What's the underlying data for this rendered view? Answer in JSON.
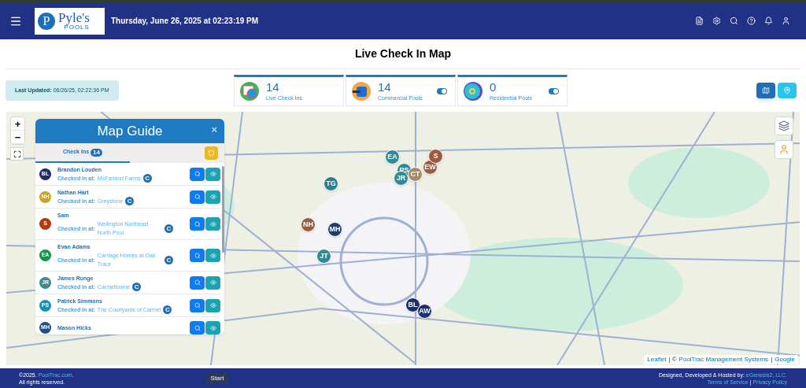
{
  "header": {
    "logo": {
      "initial": "P",
      "name": "Pyle's",
      "tagline": "POOLS"
    },
    "datetime": "Thursday, June 26, 2025 at 02:23:19 PM"
  },
  "page_title": "Live Check In Map",
  "last_updated": {
    "label": "Last Updated:",
    "value": "06/26/25, 02:22:36 PM"
  },
  "stats": [
    {
      "kind": "checkins",
      "count": "14",
      "label": "Live Check Ins"
    },
    {
      "kind": "commercial",
      "count": "14",
      "label": "Commercial Pools",
      "on": true
    },
    {
      "kind": "residential",
      "count": "0",
      "label": "Residential Pools",
      "on": true
    }
  ],
  "view_buttons": [
    {
      "kind": "map",
      "selected": true
    },
    {
      "kind": "pin",
      "selected": false
    }
  ],
  "map_guide": {
    "title": "Map Guide",
    "close": "×",
    "tab": {
      "label": "Check Ins",
      "count": "14",
      "selected": true
    },
    "rows": [
      {
        "initials": "BL",
        "color": "#1e2a6b",
        "name": "Brandon Louden",
        "label": "Checked in at:",
        "location": "McFarland Farms",
        "badge": "C"
      },
      {
        "initials": "NH",
        "color": "#c9a227",
        "name": "Nathan Hart",
        "label": "Checked in at:",
        "location": "Greystone",
        "badge": "C"
      },
      {
        "initials": "S",
        "color": "#b23a12",
        "name": "Sam",
        "label": "Checked in at:",
        "location": "Wellington Northeast - North Pool",
        "badge": "C"
      },
      {
        "initials": "EA",
        "color": "#139447",
        "name": "Evan Adams",
        "label": "Checked in at:",
        "location": "Carriage Homes at Oak Trace",
        "badge": "C"
      },
      {
        "initials": "JR",
        "color": "#3b8a8f",
        "name": "James Runge",
        "label": "Checked in at:",
        "location": "Carmeltowne",
        "badge": "C"
      },
      {
        "initials": "PS",
        "color": "#1c8fb0",
        "name": "Patrick Simmons",
        "label": "Checked in at:",
        "location": "The Courtyards of Carmel",
        "badge": "C"
      },
      {
        "initials": "MH",
        "color": "#1e4f8a",
        "name": "Mason Hicks"
      }
    ]
  },
  "markers": [
    {
      "initials": "EA",
      "color": "#2f8a95"
    },
    {
      "initials": "PS",
      "color": "#2f8a95"
    },
    {
      "initials": "JR",
      "color": "#2f8a95"
    },
    {
      "initials": "CT",
      "color": "#a88a6a"
    },
    {
      "initials": "EW",
      "color": "#9c5a3f"
    },
    {
      "initials": "S",
      "color": "#9c5a3f"
    },
    {
      "initials": "TG",
      "color": "#2f7f8f"
    },
    {
      "initials": "NH",
      "color": "#9c5a3f"
    },
    {
      "initials": "MH",
      "color": "#1e3f6e"
    },
    {
      "initials": "JT",
      "color": "#2f8a95"
    },
    {
      "initials": "BL",
      "color": "#1e2f6e"
    },
    {
      "initials": "AW",
      "color": "#1e2f6e"
    }
  ],
  "zoom_controls": [
    "+",
    "−"
  ],
  "attribution": [
    {
      "text": "Leaflet",
      "link": true
    },
    {
      "text": "| ©",
      "link": false
    },
    {
      "text": "PoolTrac Management Systems",
      "link": true
    },
    {
      "text": "|",
      "link": false
    },
    {
      "text": "Google",
      "link": true
    }
  ],
  "footer": {
    "copyright": "©2025.",
    "site": "PoolTrac.com",
    "site_end": ".",
    "rights": "All rights reserved.",
    "start": "Start",
    "credit": "Designed, Developed & Hosted by:",
    "developer": "eGenesis2, LLC.",
    "terms": "Terms of Service",
    "sep": "|",
    "privacy": "Privacy Policy"
  }
}
